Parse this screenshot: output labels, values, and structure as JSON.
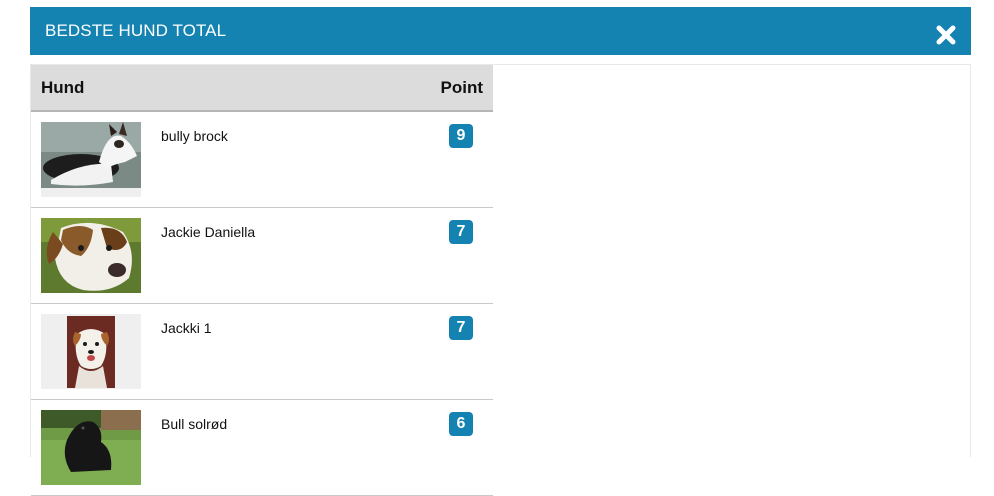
{
  "modal": {
    "title": "BEDSTE HUND TOTAL",
    "close_icon": "close-x-icon"
  },
  "table": {
    "headers": {
      "dog": "Hund",
      "points": "Point"
    },
    "rows": [
      {
        "name": "bully brock",
        "points": "9",
        "image": "bull-terrier-photo"
      },
      {
        "name": "Jackie Daniella",
        "points": "7",
        "image": "jack-russell-closeup-photo"
      },
      {
        "name": "Jackki 1",
        "points": "7",
        "image": "jack-russell-portrait-photo"
      },
      {
        "name": "Bull solrød",
        "points": "6",
        "image": "black-bulldog-photo"
      }
    ]
  },
  "colors": {
    "accent": "#1583b1",
    "header_bg": "#dcdcdc"
  }
}
